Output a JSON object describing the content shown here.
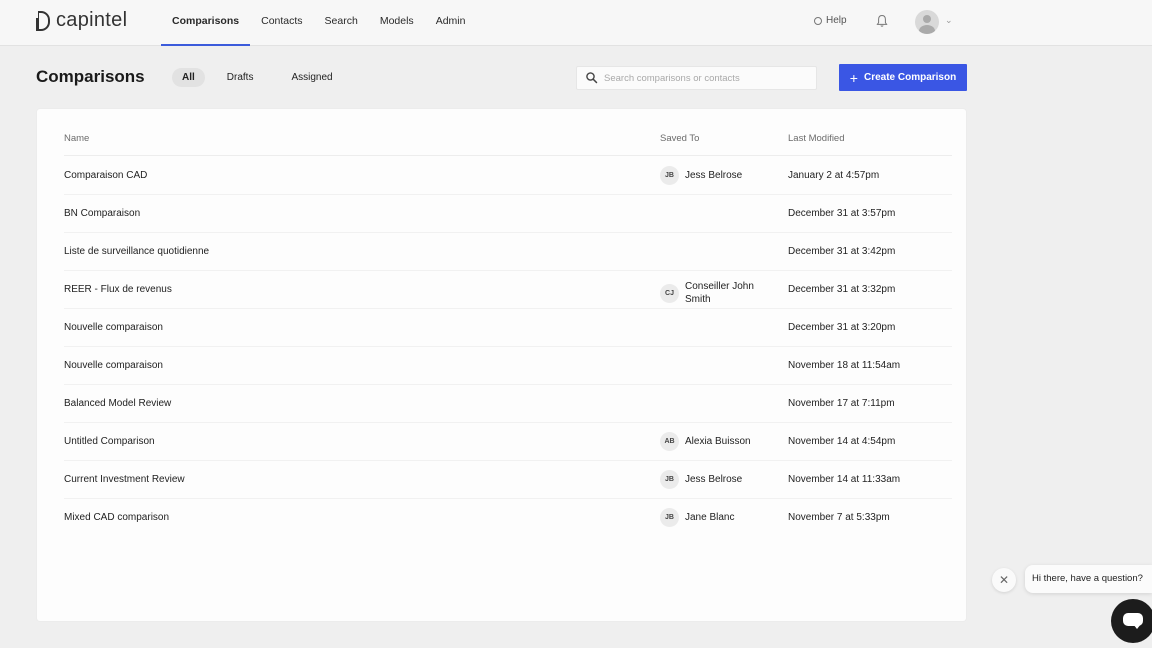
{
  "brand": {
    "name": "capintel"
  },
  "nav": {
    "items": [
      {
        "label": "Comparisons",
        "active": true
      },
      {
        "label": "Contacts",
        "active": false
      },
      {
        "label": "Search",
        "active": false
      },
      {
        "label": "Models",
        "active": false
      },
      {
        "label": "Admin",
        "active": false
      }
    ],
    "help_label": "Help"
  },
  "page": {
    "title": "Comparisons",
    "filters": [
      {
        "label": "All",
        "active": true
      },
      {
        "label": "Drafts",
        "active": false
      },
      {
        "label": "Assigned",
        "active": false
      }
    ],
    "search": {
      "placeholder": "Search comparisons or contacts",
      "value": ""
    },
    "create_label": "Create Comparison"
  },
  "table": {
    "columns": {
      "name": "Name",
      "saved_to": "Saved To",
      "last_modified": "Last Modified"
    },
    "rows": [
      {
        "name": "Comparaison CAD",
        "initials": "JB",
        "saved_to": "Jess Belrose",
        "modified": "January 2 at 4:57pm"
      },
      {
        "name": "BN Comparaison",
        "initials": "",
        "saved_to": "",
        "modified": "December 31 at 3:57pm"
      },
      {
        "name": "Liste de surveillance quotidienne",
        "initials": "",
        "saved_to": "",
        "modified": "December 31 at 3:42pm"
      },
      {
        "name": "REER - Flux de revenus",
        "initials": "CJ",
        "saved_to": "Conseiller John Smith",
        "modified": "December 31 at 3:32pm"
      },
      {
        "name": "Nouvelle comparaison",
        "initials": "",
        "saved_to": "",
        "modified": "December 31 at 3:20pm"
      },
      {
        "name": "Nouvelle comparaison",
        "initials": "",
        "saved_to": "",
        "modified": "November 18 at 11:54am"
      },
      {
        "name": "Balanced Model Review",
        "initials": "",
        "saved_to": "",
        "modified": "November 17 at 7:11pm"
      },
      {
        "name": "Untitled Comparison",
        "initials": "AB",
        "saved_to": "Alexia Buisson",
        "modified": "November 14 at 4:54pm"
      },
      {
        "name": "Current Investment Review",
        "initials": "JB",
        "saved_to": "Jess Belrose",
        "modified": "November 14 at 11:33am"
      },
      {
        "name": "Mixed CAD comparison",
        "initials": "JB",
        "saved_to": "Jane Blanc",
        "modified": "November 7 at 5:33pm"
      }
    ]
  },
  "chat": {
    "message": "Hi there, have a question?"
  },
  "colors": {
    "accent": "#3a56e4",
    "background": "#efefef",
    "launcher": "#1c1c1c"
  },
  "icons": [
    "logo-icon",
    "help-icon",
    "bell-icon",
    "avatar-icon",
    "chevron-down-icon",
    "search-icon",
    "plus-icon",
    "close-icon",
    "chat-icon"
  ]
}
